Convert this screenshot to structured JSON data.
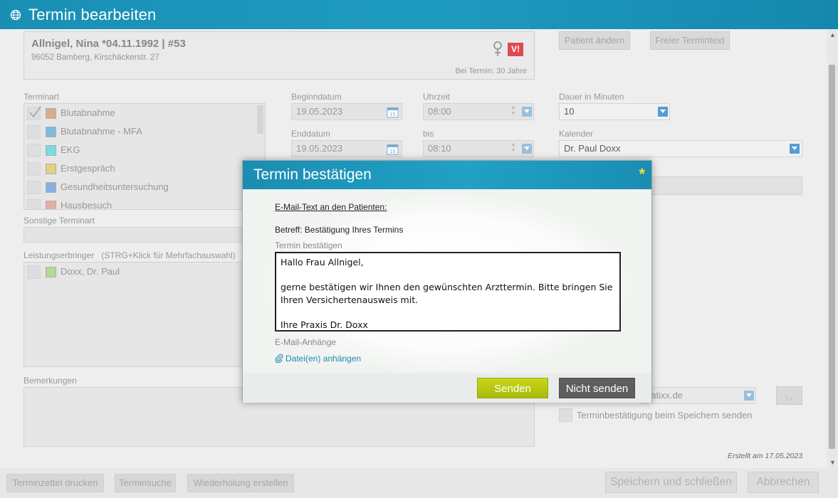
{
  "window": {
    "title": "Termin bearbeiten"
  },
  "patient": {
    "name": "Allnigel, Nina *04.11.1992 | #53",
    "address": "96052 Bamberg, Kirschäckerstr. 27",
    "age_at_appointment": "Bei Termin: 30 Jahre",
    "vip_badge": "V!"
  },
  "top_buttons": {
    "change_patient": "Patient ändern",
    "free_text": "Freier Termintext"
  },
  "appointment_types": {
    "label": "Terminart",
    "items": [
      {
        "label": "Blutabnahme",
        "color": "#d0844e",
        "checked": true
      },
      {
        "label": "Blutabnahme - MFA",
        "color": "#3a9fd0",
        "checked": false
      },
      {
        "label": "EKG",
        "color": "#2fd6e0",
        "checked": false
      },
      {
        "label": "Erstgespräch",
        "color": "#e0c040",
        "checked": false
      },
      {
        "label": "Gesundheitsuntersuchung",
        "color": "#4a8fe0",
        "checked": false
      },
      {
        "label": "Hausbesuch",
        "color": "#e08a70",
        "checked": false
      }
    ]
  },
  "other_type": {
    "label": "Sonstige Terminart",
    "value": ""
  },
  "providers": {
    "label": "Leistungserbringer",
    "hint": "(STRG+Klick für Mehrfachauswahl)",
    "items": [
      {
        "label": "Doxx, Dr. Paul",
        "color": "#8fd060"
      }
    ]
  },
  "remarks": {
    "label": "Bemerkungen",
    "value": ""
  },
  "schedule": {
    "start_date_label": "Beginndatum",
    "start_date": "19.05.2023",
    "start_time_label": "Uhrzeit",
    "start_time": "08:00",
    "end_date_label": "Enddatum",
    "end_date": "19.05.2023",
    "end_time_label": "bis",
    "end_time": "08:10",
    "duration_label": "Dauer in Minuten",
    "duration": "10",
    "calendar_label": "Kalender",
    "calendar": "Dr. Paul Doxx",
    "calendar_icon_day": "15"
  },
  "email_select": {
    "value": "datixx.de"
  },
  "confirm_on_save": {
    "label": "Terminbestätigung beim Speichern senden",
    "checked": false
  },
  "created": "Erstellt am 17.05.2023",
  "bottom_buttons": {
    "print": "Terminzettel drucken",
    "search": "Terminsuche",
    "repeat": "Wiederholung erstellen",
    "save_close": "Speichern und schließen",
    "cancel": "Abbrechen"
  },
  "modal": {
    "title": "Termin bestätigen",
    "star": "*",
    "email_heading": "E-Mail-Text an den Patienten:",
    "subject": "Betreff: Bestätigung Ihres Termins",
    "message_label": "Termin bestätigen",
    "message": "Hallo Frau Allnigel,\n\ngerne bestätigen wir Ihnen den gewünschten Arzttermin. Bitte bringen Sie Ihren Versichertenausweis mit.\n\nIhre Praxis Dr. Doxx",
    "attachments_label": "E-Mail-Anhänge",
    "attach_link": "Datei(en) anhängen",
    "send_button": "Senden",
    "dont_send_button": "Nicht senden"
  },
  "icons": {
    "globe": "globe-icon",
    "female": "female-icon",
    "calendar": "calendar-icon",
    "paperclip": "paperclip-icon",
    "dropdown": "chevron-down-icon",
    "star": "asterisk-icon"
  },
  "colors": {
    "accent": "#1e9ac0",
    "send": "#b4c510",
    "dont_send": "#5e5e5e",
    "vip": "#d9313b",
    "highlight_star": "#f5e02a"
  }
}
